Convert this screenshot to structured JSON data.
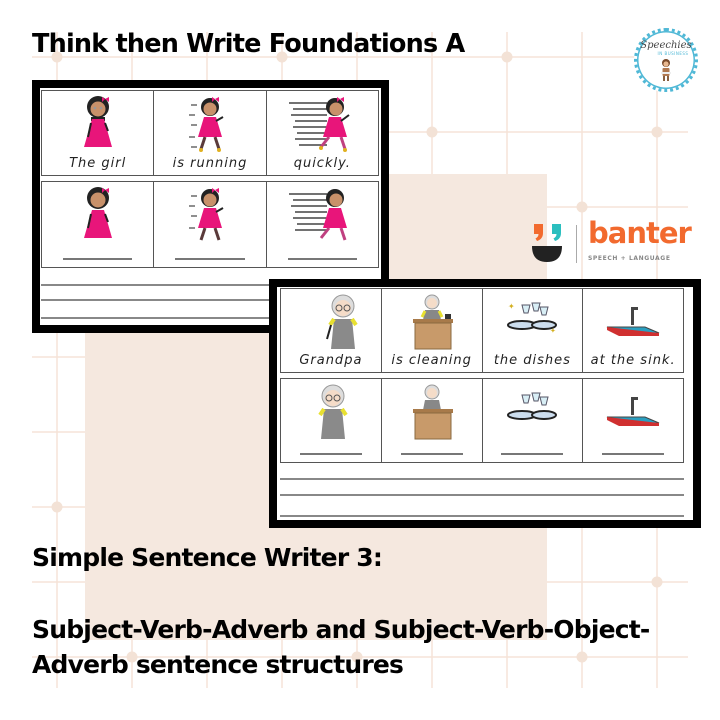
{
  "titles": {
    "main": "Think then Write Foundations A",
    "subtitle": "Simple Sentence Writer 3:",
    "description": "Subject-Verb-Adverb and Subject-Verb-Object-Adverb sentence structures"
  },
  "logos": {
    "speechies": {
      "name": "Speechies",
      "tagline": "IN BUSINESS",
      "border_color": "#4fb8d6"
    },
    "banter": {
      "name": "banter",
      "tagline": "SPEECH + LANGUAGE",
      "colors": {
        "orange": "#f26a2e",
        "teal": "#2bbfbf",
        "bowl": "#222222"
      }
    }
  },
  "worksheet_1": {
    "row_model": [
      {
        "word": "The girl",
        "icon": "girl-standing-icon"
      },
      {
        "word": "is running",
        "icon": "girl-running-icon"
      },
      {
        "word": "quickly.",
        "icon": "girl-running-fast-icon"
      }
    ],
    "row_blank": [
      {
        "icon": "girl-standing-icon"
      },
      {
        "icon": "girl-running-icon"
      },
      {
        "icon": "girl-running-fast-icon"
      }
    ],
    "ruled_lines": 3
  },
  "worksheet_2": {
    "row_model": [
      {
        "word": "Grandpa",
        "icon": "grandpa-icon"
      },
      {
        "word": "is cleaning",
        "icon": "grandpa-at-desk-icon"
      },
      {
        "word": "the dishes",
        "icon": "dishes-icon"
      },
      {
        "word": "at the sink.",
        "icon": "sink-icon"
      }
    ],
    "row_blank": [
      {
        "icon": "grandpa-icon"
      },
      {
        "icon": "grandpa-at-desk-icon"
      },
      {
        "icon": "dishes-icon"
      },
      {
        "icon": "sink-icon"
      }
    ],
    "ruled_lines": 3
  },
  "colors": {
    "grid_line": "#f5e3d8",
    "peach_panel": "#f5e8df",
    "girl_dress": "#e8157a",
    "desk": "#c89a6a"
  }
}
